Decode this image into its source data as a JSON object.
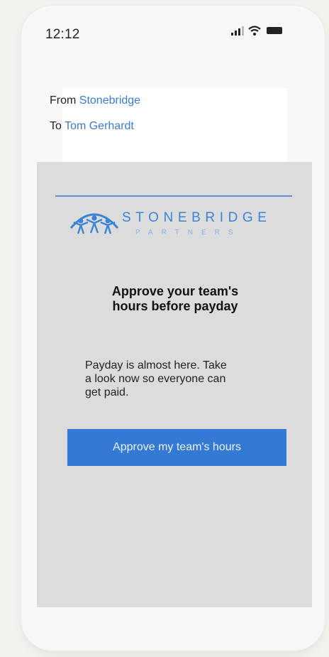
{
  "status_bar": {
    "time": "12:12",
    "icons": [
      "signal-icon",
      "wifi-icon",
      "battery-icon"
    ]
  },
  "email_header": {
    "from_label": "From",
    "from_value": "Stonebridge",
    "to_label": "To",
    "to_value": "Tom Gerhardt"
  },
  "email": {
    "logo": {
      "name": "STONEBRIDGE",
      "subtitle": "PARTNERS"
    },
    "headline_line1": "Approve your team's",
    "headline_line2": "hours before payday",
    "body_line1": "Payday is almost here. Take",
    "body_line2": "a look now so everyone can",
    "body_line3": "get paid.",
    "cta_label": "Approve my team's hours"
  },
  "colors": {
    "accent": "#3479d4",
    "link": "#3a7bd5",
    "email_background": "#dcdcdc"
  }
}
